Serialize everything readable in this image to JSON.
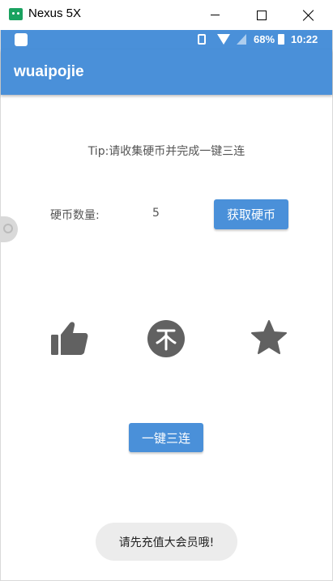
{
  "window": {
    "title": "Nexus 5X",
    "app_icon": "android-emulator-icon"
  },
  "status_bar": {
    "battery_percent": "68%",
    "time": "10:22",
    "icons": [
      "notification-icon",
      "vibrate-icon",
      "wifi-icon",
      "signal-icon",
      "battery-icon"
    ]
  },
  "app_bar": {
    "title": "wuaipojie"
  },
  "main": {
    "tip": "Tip:请收集硬币并完成一键三连",
    "coins_label": "硬币数量:",
    "coins_value": "5",
    "get_coins_button": "获取硬币",
    "triple_button": "一键三连",
    "action_icons": [
      "thumbs-up-icon",
      "coin-icon",
      "star-icon"
    ]
  },
  "toast": {
    "message": "请先充值大会员哦!"
  },
  "colors": {
    "accent": "#4a90d9",
    "icon_gray": "#616161",
    "text_gray": "#555555",
    "toast_bg": "#ececec"
  }
}
